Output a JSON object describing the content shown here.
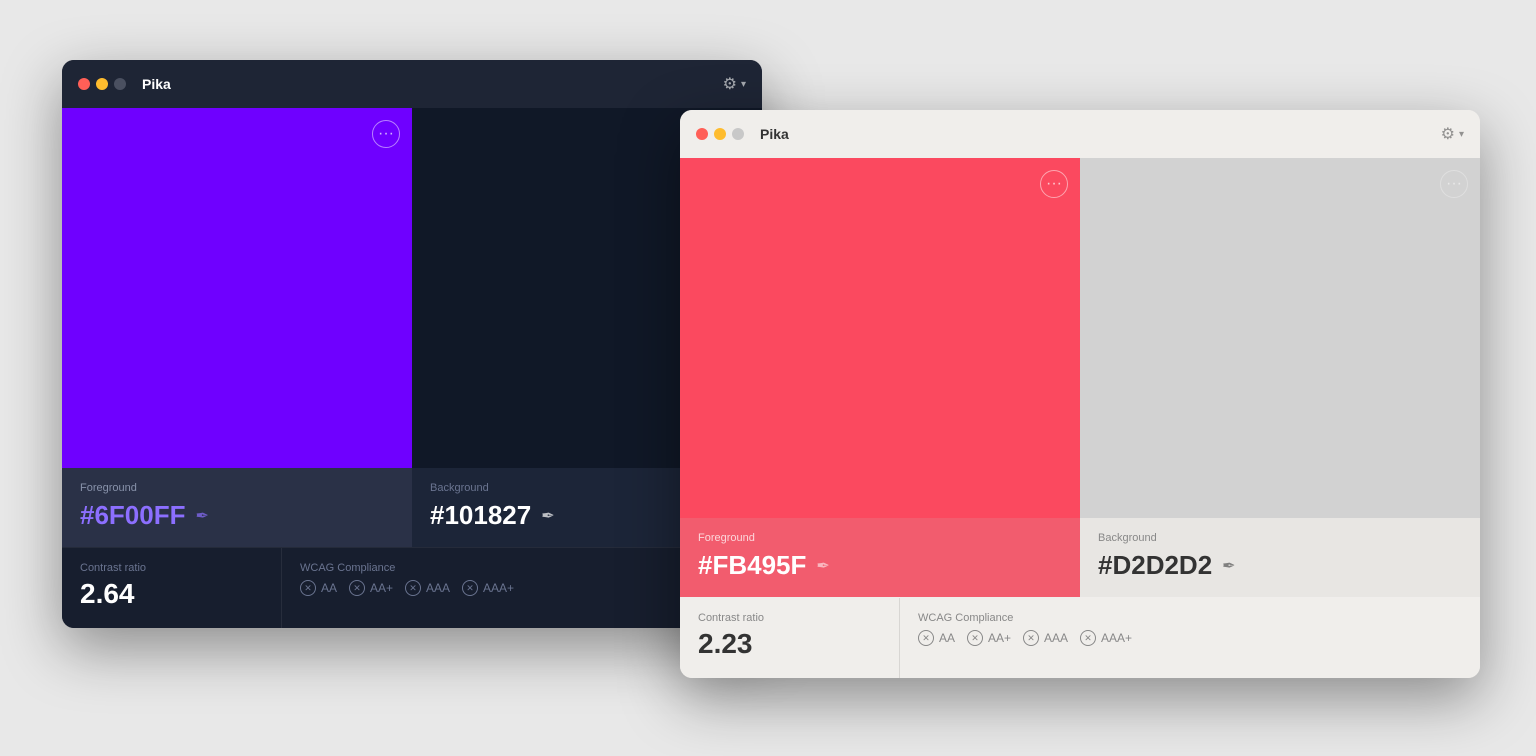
{
  "window_dark": {
    "title": "Pika",
    "traffic_lights": [
      "red",
      "yellow",
      "gray"
    ],
    "foreground": {
      "label": "Foreground",
      "hex": "#6F00FF",
      "swatch_color": "#6F00FF"
    },
    "background": {
      "label": "Background",
      "hex": "#101827",
      "swatch_color": "#101827"
    },
    "contrast": {
      "label": "Contrast ratio",
      "value": "2.64"
    },
    "wcag": {
      "label": "WCAG Compliance",
      "badges": [
        "AA",
        "AA+",
        "AAA",
        "AAA+"
      ]
    }
  },
  "window_light": {
    "title": "Pika",
    "traffic_lights": [
      "red",
      "yellow",
      "lightgray"
    ],
    "foreground": {
      "label": "Foreground",
      "hex": "#FB495F",
      "swatch_color": "#FB495F"
    },
    "background": {
      "label": "Background",
      "hex": "#D2D2D2",
      "swatch_color": "#D2D2D2"
    },
    "contrast": {
      "label": "Contrast ratio",
      "value": "2.23"
    },
    "wcag": {
      "label": "WCAG Compliance",
      "badges": [
        "AA",
        "AA+",
        "AAA",
        "AAA+"
      ]
    }
  },
  "icons": {
    "gear": "⚙",
    "chevron": "▾",
    "eyedropper": "✒",
    "more": "···",
    "x": "✕"
  }
}
